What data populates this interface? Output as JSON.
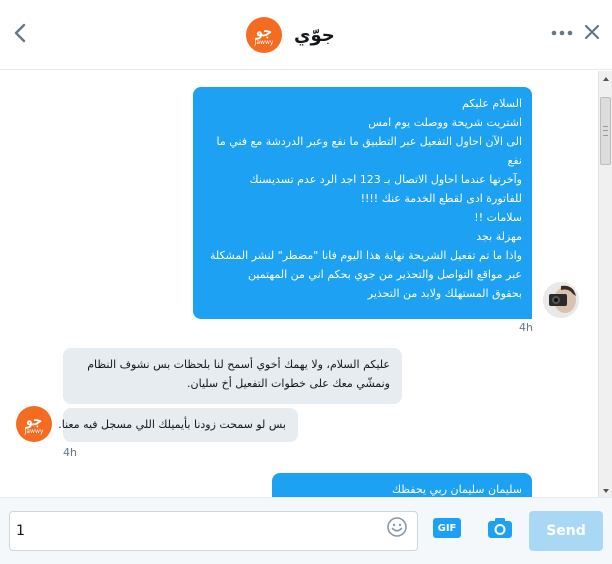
{
  "header": {
    "title": "جوّي",
    "logo_glyph": "جو",
    "logo_word": "Jawwy",
    "accent": "#f36c21"
  },
  "messages": [
    {
      "direction": "outgoing",
      "lines": [
        "السلام عليكم",
        "اشتريت شريحة    ووصلت يوم امس",
        "الى الآن احاول التفعيل   عبر التطبيق ما نفع  وعبر الدردشة مع فني  ما",
        "نفع",
        "وآخرتها عندما احاول الاتصال بـ 123    اجد الرد    عدم تسديسنك",
        "للفاتورة ادى لقطع الخدمة عنك !!!!",
        "سلامات !!",
        "مهزلة بجد",
        "واذا ما تم تفعيل الشريحة   نهاية هذا اليوم فانا \"مضطر\" لنشر المشكلة",
        "عبر مواقع التواصل والتحذير من   جوي    بحكم اني  من المهتمين",
        "بحقوق المستهلك  ولابد من التحذير"
      ],
      "timestamp": "4h",
      "color": "#1da1f2"
    },
    {
      "direction": "incoming",
      "lines": [
        "عليكم السلام، ولا يهمك أخوي أسمح لنا بلحظات بس نشوف النظام",
        "ونمشّي معك على خطوات التفعيل أخ سليان."
      ]
    },
    {
      "direction": "incoming",
      "lines": [
        "بس لو سمحت زودنا بأيميلك اللي مسجل فيه معنا."
      ],
      "timestamp": "4h"
    },
    {
      "direction": "outgoing",
      "lines": [
        "سليمان    سليمان    ربي يحفظك"
      ]
    }
  ],
  "composer": {
    "value": "1",
    "placeholder": "",
    "gif_label": "GIF",
    "send_label": "Send"
  },
  "icons": {
    "back": "chevron-left-icon",
    "more": "more-dots-icon",
    "close": "close-icon",
    "emoji": "emoji-icon",
    "gif": "gif-icon",
    "photo": "camera-icon"
  }
}
